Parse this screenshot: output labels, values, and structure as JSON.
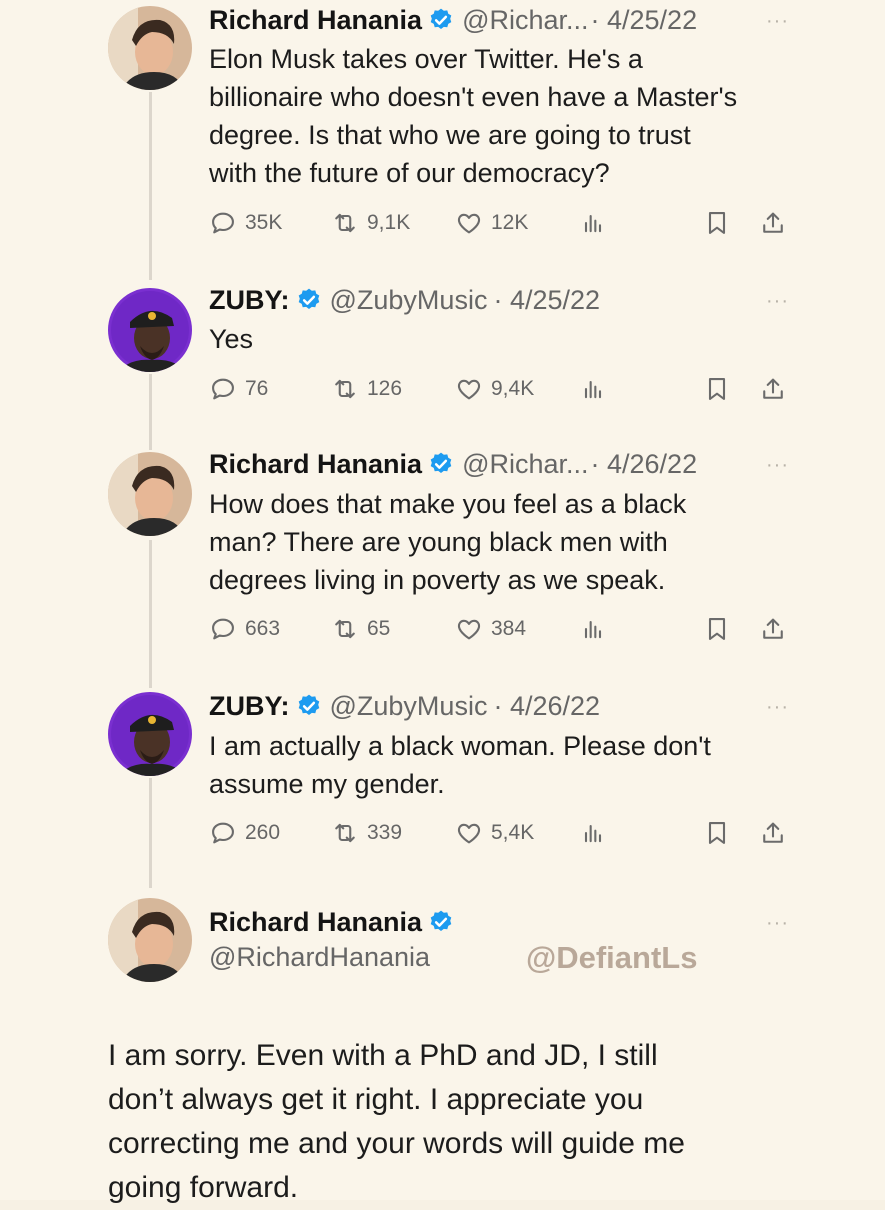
{
  "tweets": [
    {
      "name": "Richard Hanania",
      "handle": "@Richar...",
      "date": "· 4/25/22",
      "more": "···",
      "lines": [
        "Elon Musk takes over Twitter. He's a",
        "billionaire who doesn't even have a Master's",
        "degree. Is that who we are going to trust",
        "with the future of our democracy?"
      ],
      "replies": "35K",
      "retweets": "9,1K",
      "likes": "12K"
    },
    {
      "name": "ZUBY:",
      "handle": "@ZubyMusic",
      "date": "· 4/25/22",
      "more": "···",
      "lines": [
        "Yes"
      ],
      "replies": "76",
      "retweets": "126",
      "likes": "9,4K"
    },
    {
      "name": "Richard Hanania",
      "handle": "@Richar...",
      "date": "· 4/26/22",
      "more": "···",
      "lines": [
        "How does that make you feel as a black",
        "man? There are young black men with",
        "degrees living in poverty as we speak."
      ],
      "replies": "663",
      "retweets": "65",
      "likes": "384"
    },
    {
      "name": "ZUBY:",
      "handle": "@ZubyMusic",
      "date": "· 4/26/22",
      "more": "···",
      "lines": [
        "I am actually a black woman. Please don't",
        "assume my gender."
      ],
      "replies": "260",
      "retweets": "339",
      "likes": "5,4K"
    }
  ],
  "final_tweet": {
    "name": "Richard Hanania",
    "handle": "@RichardHanania",
    "more": "···",
    "watermark": "@DefiantLs",
    "lines": [
      "I am sorry. Even with a PhD and JD, I still",
      "don’t always get it right. I appreciate you",
      "correcting me and your words will guide me",
      "going forward."
    ]
  },
  "colors": {
    "verified": "#1d9bf0",
    "background": "#faf5ea",
    "zuby_avatar": "#7a2fd0"
  },
  "icons": [
    "reply-icon",
    "retweet-icon",
    "like-icon",
    "views-icon",
    "bookmark-icon",
    "share-icon",
    "verified-badge-icon"
  ]
}
